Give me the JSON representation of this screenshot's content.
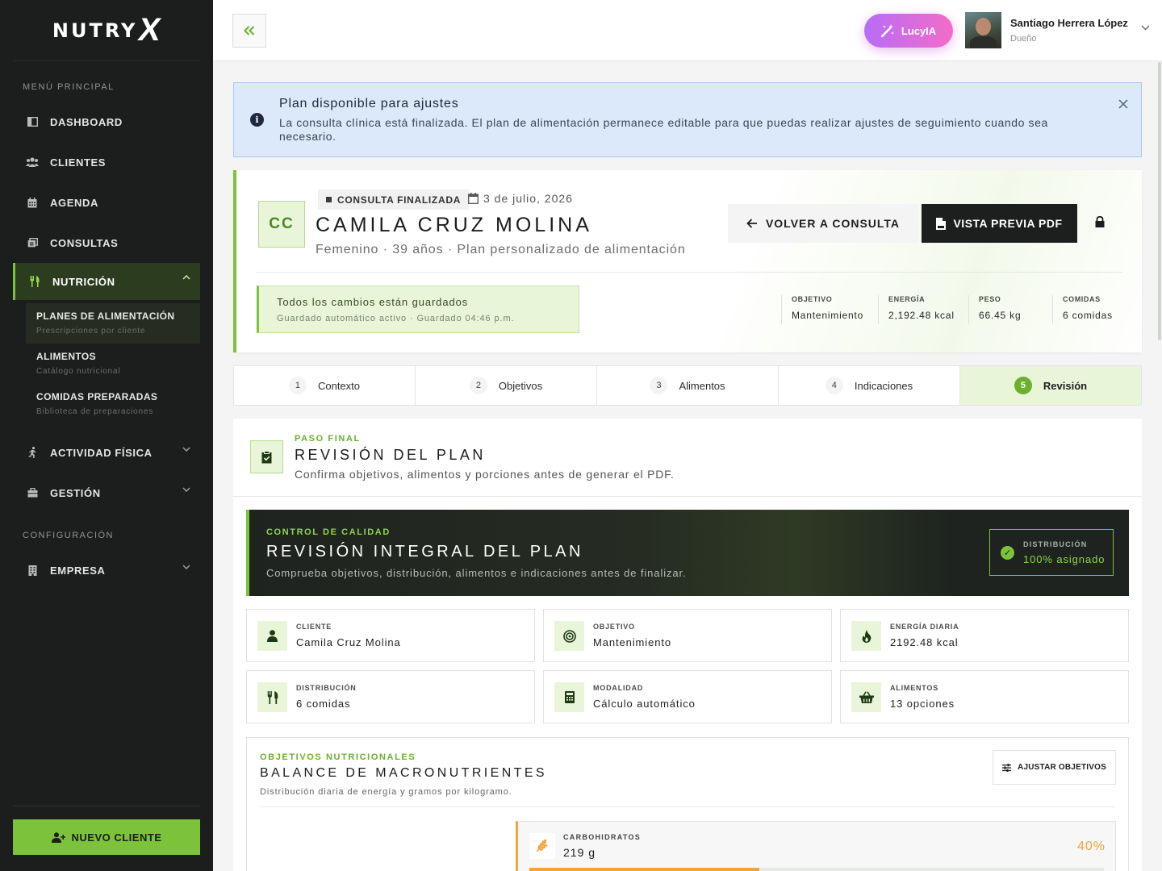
{
  "brand": {
    "logo_text": "NUTRY",
    "logo_mark": "X"
  },
  "sidebar": {
    "section_main": "MENÚ PRINCIPAL",
    "section_config": "CONFIGURACIÓN",
    "items": {
      "dashboard": "DASHBOARD",
      "clients": "CLIENTES",
      "agenda": "AGENDA",
      "consults": "CONSULTAS",
      "nutrition": "NUTRICIÓN",
      "activity": "ACTIVIDAD FÍSICA",
      "management": "GESTIÓN",
      "company": "EMPRESA"
    },
    "submenu": [
      {
        "title": "PLANES DE ALIMENTACIÓN",
        "desc": "Prescripciones por cliente"
      },
      {
        "title": "ALIMENTOS",
        "desc": "Catálogo nutricional"
      },
      {
        "title": "COMIDAS PREPARADAS",
        "desc": "Biblioteca de preparaciones"
      }
    ],
    "new_client": "NUEVO CLIENTE"
  },
  "topbar": {
    "collapse_icon": "double-chevron-left-icon",
    "lucy_label": "LucyIA",
    "user_name": "Santiago Herrera López",
    "user_role": "Dueño"
  },
  "alert": {
    "title": "Plan disponible para ajustes",
    "body": "La consulta clínica está finalizada. El plan de alimentación permanece editable para que puedas realizar ajustes de seguimiento cuando sea necesario."
  },
  "patient": {
    "initials": "CC",
    "status": "CONSULTA FINALIZADA",
    "date": "3 de julio, 2026",
    "name": "CAMILA CRUZ MOLINA",
    "meta": "Femenino · 39 años · Plan personalizado de alimentación",
    "back_label": "VOLVER A CONSULTA",
    "pdf_label": "VISTA PREVIA PDF",
    "saved_title": "Todos los cambios están guardados",
    "saved_sub": "Guardado automático activo · Guardado 04:46 p.m.",
    "stats": [
      {
        "label": "OBJETIVO",
        "value": "Mantenimiento"
      },
      {
        "label": "ENERGÍA",
        "value": "2,192.48 kcal"
      },
      {
        "label": "PESO",
        "value": "66.45 kg"
      },
      {
        "label": "COMIDAS",
        "value": "6 comidas"
      }
    ]
  },
  "steps": [
    {
      "num": "1",
      "label": "Contexto"
    },
    {
      "num": "2",
      "label": "Objetivos"
    },
    {
      "num": "3",
      "label": "Alimentos"
    },
    {
      "num": "4",
      "label": "Indicaciones"
    },
    {
      "num": "5",
      "label": "Revisión"
    }
  ],
  "review": {
    "eyebrow": "PASO FINAL",
    "title": "REVISIÓN DEL PLAN",
    "sub": "Confirma objetivos, alimentos y porciones antes de generar el PDF."
  },
  "quality": {
    "eyebrow": "CONTROL DE CALIDAD",
    "title": "REVISIÓN INTEGRAL DEL PLAN",
    "sub": "Comprueba objetivos, distribución, alimentos e indicaciones antes de finalizar.",
    "badge_label": "DISTRIBUCIÓN",
    "badge_value": "100% asignado"
  },
  "tiles": [
    {
      "label": "CLIENTE",
      "value": "Camila Cruz Molina"
    },
    {
      "label": "OBJETIVO",
      "value": "Mantenimiento"
    },
    {
      "label": "ENERGÍA DIARIA",
      "value": "2192.48 kcal"
    },
    {
      "label": "DISTRIBUCIÓN",
      "value": "6 comidas"
    },
    {
      "label": "MODALIDAD",
      "value": "Cálculo automático"
    },
    {
      "label": "ALIMENTOS",
      "value": "13 opciones"
    }
  ],
  "macros": {
    "eyebrow": "OBJETIVOS NUTRICIONALES",
    "title": "BALANCE DE MACRONUTRIENTES",
    "sub": "Distribución diaria de energía y gramos por kilogramo.",
    "adjust_label": "AJUSTAR OBJETIVOS",
    "carbs": {
      "label": "CARBOHIDRATOS",
      "value": "219 g",
      "pct": "40%",
      "fill_pct": 40
    }
  },
  "colors": {
    "accent": "#7cc23a",
    "sidebar_bg": "#1c1e1d",
    "carb": "#f0a53a"
  }
}
